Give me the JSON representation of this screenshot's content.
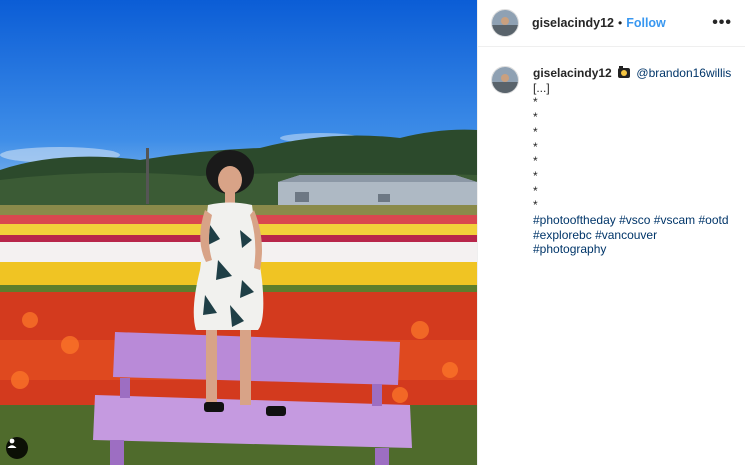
{
  "header": {
    "username": "giselacindy12",
    "separator": "•",
    "follow_label": "Follow",
    "more_label": "•••"
  },
  "caption": {
    "username": "giselacindy12",
    "camera_icon": "camera-emoji",
    "mention": "@brandon16willis",
    "lines": [
      "[...]",
      "*",
      "*",
      "*",
      "*",
      "*",
      "*",
      "*",
      "*"
    ],
    "hashtags_line1": [
      "#photooftheday",
      "#vsco",
      "#vscam",
      "#ootd"
    ],
    "hashtags_line2": [
      "#explorebc",
      "#vancouver",
      "#photography"
    ]
  },
  "colors": {
    "follow": "#3897f0",
    "link": "#003569",
    "text": "#262626"
  }
}
